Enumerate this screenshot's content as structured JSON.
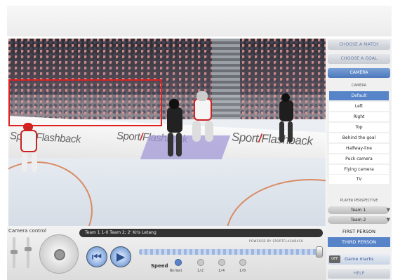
{
  "scene": {
    "ads": [
      "Sport",
      "Flashback",
      "Sport",
      "Flashback",
      "Sport",
      "Flashback"
    ]
  },
  "controls": {
    "camera_control_label": "Camera control",
    "caption": "Team 1 1-0 Team 2; 2' Kris Letang",
    "powered_by": "POWERED BY SPORTFLASHBACK",
    "prev_icon": "skip-back-icon",
    "play_icon": "play-icon",
    "speed_label": "Speed",
    "speed_options": [
      "Normal",
      "1/2",
      "1/4",
      "1/8"
    ],
    "speed_selected": "Normal"
  },
  "panel": {
    "choose_match": "CHOOSE A MATCH",
    "choose_goal": "CHOOSE A GOAL",
    "camera_tab": "CAMERA",
    "camera_section_title": "CAMERA",
    "camera_options": [
      "Default",
      "Left",
      "Right",
      "Top",
      "Behind the goal",
      "Halfway-line",
      "Puck camera",
      "Flying camera",
      "TV"
    ],
    "camera_selected": "Default",
    "player_perspective_title": "PLAYER PERSPECTIVE",
    "team1": "Team 1",
    "team2": "Team 2",
    "first_person": "FIRST PERSON",
    "third_person": "THIRD PERSON",
    "game_marks_toggle": "OFF",
    "game_marks": "Game marks",
    "help": "HELP"
  },
  "colors": {
    "accent": "#5784c9",
    "highlight_box": "#e02020"
  }
}
